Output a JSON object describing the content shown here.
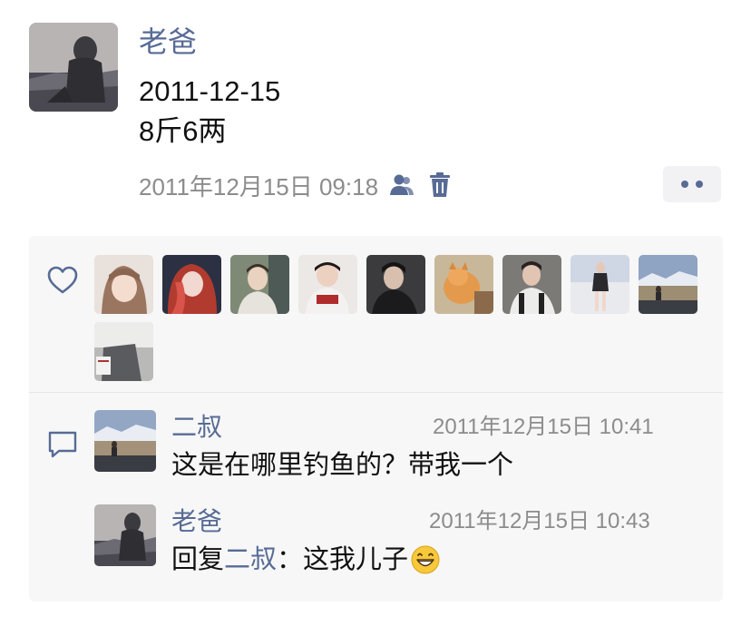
{
  "post": {
    "author": "老爸",
    "lines": [
      "2011-12-15",
      "8斤6两"
    ],
    "time": "2011年12月15日 09:18",
    "icons": {
      "visibility": "contacts-icon",
      "delete": "trash-icon",
      "more": "more-dots-icon"
    }
  },
  "likes": {
    "icon": "heart-icon",
    "avatars": [
      "liker-avatar-1",
      "liker-avatar-2",
      "liker-avatar-3",
      "liker-avatar-4",
      "liker-avatar-5",
      "liker-avatar-6",
      "liker-avatar-7",
      "liker-avatar-8",
      "liker-avatar-9",
      "liker-avatar-10"
    ]
  },
  "comments": {
    "icon": "comment-icon",
    "items": [
      {
        "name": "二叔",
        "time": "2011年12月15日 10:41",
        "text": "这是在哪里钓鱼的？带我一个"
      },
      {
        "name": "老爸",
        "time": "2011年12月15日 10:43",
        "reply_prefix": "回复",
        "reply_to": "二叔",
        "reply_colon": "：",
        "text": "这我儿子",
        "emoji": "grinning-face-emoji"
      }
    ]
  },
  "colors": {
    "name_link": "#576b95",
    "meta_gray": "#8c8c8c",
    "panel_bg": "#f7f7f7"
  }
}
